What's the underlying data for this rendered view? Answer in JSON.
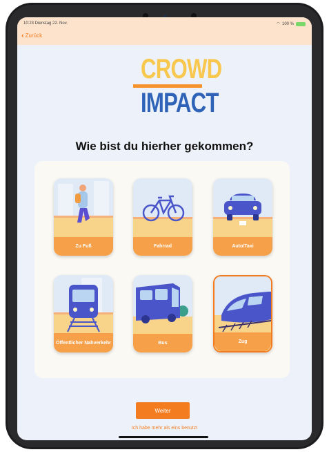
{
  "status": {
    "time_date": "10:23  Dienstag 22. Nov.",
    "battery_pct": "100 %"
  },
  "nav": {
    "back_label": "Zurück"
  },
  "logo": {
    "line1": "CROWD",
    "line2": "IMPACT"
  },
  "question": "Wie bist du hierher gekommen?",
  "options": [
    {
      "label": "Zu Fuß",
      "icon": "walking-person-icon",
      "selected": false
    },
    {
      "label": "Fahrrad",
      "icon": "bicycle-icon",
      "selected": false
    },
    {
      "label": "Auto/Taxi",
      "icon": "car-icon",
      "selected": false
    },
    {
      "label": "Öffentlicher Nahverkehr",
      "icon": "tram-icon",
      "selected": false
    },
    {
      "label": "Bus",
      "icon": "bus-icon",
      "selected": false
    },
    {
      "label": "Zug",
      "icon": "train-icon",
      "selected": true
    }
  ],
  "actions": {
    "continue_label": "Weiter",
    "multiple_label": "Ich habe mehr als eins benutzt"
  },
  "colors": {
    "accent": "#f47c20",
    "tile_label_bg": "#f7a04a",
    "logo_yellow": "#f8c74e",
    "logo_blue": "#2e63b8",
    "header_bg": "#fde3cc"
  }
}
